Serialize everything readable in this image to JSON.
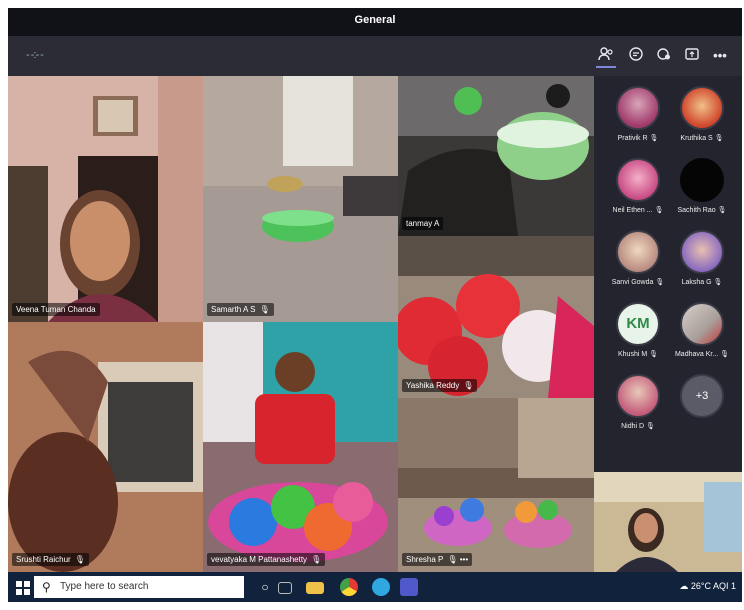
{
  "window": {
    "title": "General"
  },
  "toolbar": {
    "icons": [
      "people-icon",
      "chat-icon",
      "reactions-icon",
      "share-icon",
      "more-icon"
    ]
  },
  "tiles": [
    {
      "name": "Veena Tuman Chanda",
      "mic": "🎙"
    },
    {
      "name": "Samarth A S",
      "mic": "🎙"
    },
    {
      "name": "tanmay A",
      "mic": ""
    },
    {
      "name": "Yashika Reddy",
      "mic": "🎙"
    },
    {
      "name": "Srushti Raichur",
      "mic": "🎙"
    },
    {
      "name": "vevatyaka M Pattanashetty",
      "mic": "🎙"
    },
    {
      "name": "Shresha P",
      "mic": "🎙",
      "extra": "•••"
    }
  ],
  "participants": [
    {
      "name": "Prativik R",
      "mic": "🎙"
    },
    {
      "name": "Kruthika S",
      "mic": "🎙"
    },
    {
      "name": "Neil Ethen ...",
      "mic": "🎙"
    },
    {
      "name": "Sachith Rao",
      "mic": "🎙"
    },
    {
      "name": "Sanvi Gowda",
      "mic": "🎙"
    },
    {
      "name": "Laksha G",
      "mic": "🎙"
    },
    {
      "name": "Khushi M",
      "mic": "🎙",
      "initials": "KM"
    },
    {
      "name": "Madhava Kr...",
      "mic": "🎙"
    },
    {
      "name": "Nidhi D",
      "mic": "🎙"
    }
  ],
  "more_count": "+3",
  "taskbar": {
    "search_placeholder": "Type here to search",
    "weather": "26°C",
    "aqi": "AQI 1"
  },
  "colors": {
    "background": "#23242e",
    "accent": "#7f86d8",
    "taskbar": "#10223c"
  }
}
